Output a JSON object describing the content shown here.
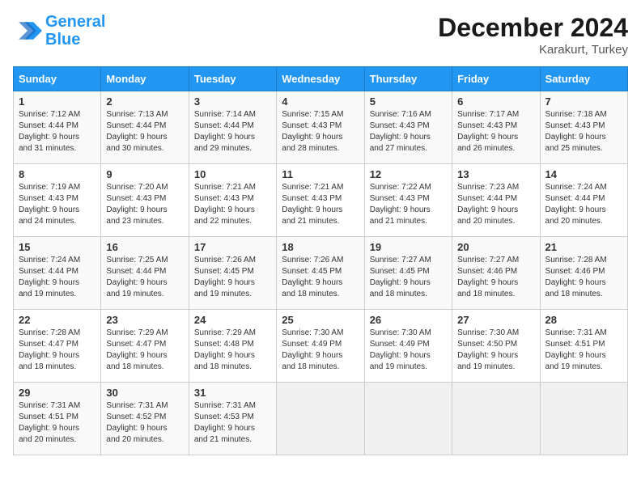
{
  "header": {
    "logo_line1": "General",
    "logo_line2": "Blue",
    "month": "December 2024",
    "location": "Karakurt, Turkey"
  },
  "days_of_week": [
    "Sunday",
    "Monday",
    "Tuesday",
    "Wednesday",
    "Thursday",
    "Friday",
    "Saturday"
  ],
  "weeks": [
    [
      {
        "day": "1",
        "info": "Sunrise: 7:12 AM\nSunset: 4:44 PM\nDaylight: 9 hours\nand 31 minutes."
      },
      {
        "day": "2",
        "info": "Sunrise: 7:13 AM\nSunset: 4:44 PM\nDaylight: 9 hours\nand 30 minutes."
      },
      {
        "day": "3",
        "info": "Sunrise: 7:14 AM\nSunset: 4:44 PM\nDaylight: 9 hours\nand 29 minutes."
      },
      {
        "day": "4",
        "info": "Sunrise: 7:15 AM\nSunset: 4:43 PM\nDaylight: 9 hours\nand 28 minutes."
      },
      {
        "day": "5",
        "info": "Sunrise: 7:16 AM\nSunset: 4:43 PM\nDaylight: 9 hours\nand 27 minutes."
      },
      {
        "day": "6",
        "info": "Sunrise: 7:17 AM\nSunset: 4:43 PM\nDaylight: 9 hours\nand 26 minutes."
      },
      {
        "day": "7",
        "info": "Sunrise: 7:18 AM\nSunset: 4:43 PM\nDaylight: 9 hours\nand 25 minutes."
      }
    ],
    [
      {
        "day": "8",
        "info": "Sunrise: 7:19 AM\nSunset: 4:43 PM\nDaylight: 9 hours\nand 24 minutes."
      },
      {
        "day": "9",
        "info": "Sunrise: 7:20 AM\nSunset: 4:43 PM\nDaylight: 9 hours\nand 23 minutes."
      },
      {
        "day": "10",
        "info": "Sunrise: 7:21 AM\nSunset: 4:43 PM\nDaylight: 9 hours\nand 22 minutes."
      },
      {
        "day": "11",
        "info": "Sunrise: 7:21 AM\nSunset: 4:43 PM\nDaylight: 9 hours\nand 21 minutes."
      },
      {
        "day": "12",
        "info": "Sunrise: 7:22 AM\nSunset: 4:43 PM\nDaylight: 9 hours\nand 21 minutes."
      },
      {
        "day": "13",
        "info": "Sunrise: 7:23 AM\nSunset: 4:44 PM\nDaylight: 9 hours\nand 20 minutes."
      },
      {
        "day": "14",
        "info": "Sunrise: 7:24 AM\nSunset: 4:44 PM\nDaylight: 9 hours\nand 20 minutes."
      }
    ],
    [
      {
        "day": "15",
        "info": "Sunrise: 7:24 AM\nSunset: 4:44 PM\nDaylight: 9 hours\nand 19 minutes."
      },
      {
        "day": "16",
        "info": "Sunrise: 7:25 AM\nSunset: 4:44 PM\nDaylight: 9 hours\nand 19 minutes."
      },
      {
        "day": "17",
        "info": "Sunrise: 7:26 AM\nSunset: 4:45 PM\nDaylight: 9 hours\nand 19 minutes."
      },
      {
        "day": "18",
        "info": "Sunrise: 7:26 AM\nSunset: 4:45 PM\nDaylight: 9 hours\nand 18 minutes."
      },
      {
        "day": "19",
        "info": "Sunrise: 7:27 AM\nSunset: 4:45 PM\nDaylight: 9 hours\nand 18 minutes."
      },
      {
        "day": "20",
        "info": "Sunrise: 7:27 AM\nSunset: 4:46 PM\nDaylight: 9 hours\nand 18 minutes."
      },
      {
        "day": "21",
        "info": "Sunrise: 7:28 AM\nSunset: 4:46 PM\nDaylight: 9 hours\nand 18 minutes."
      }
    ],
    [
      {
        "day": "22",
        "info": "Sunrise: 7:28 AM\nSunset: 4:47 PM\nDaylight: 9 hours\nand 18 minutes."
      },
      {
        "day": "23",
        "info": "Sunrise: 7:29 AM\nSunset: 4:47 PM\nDaylight: 9 hours\nand 18 minutes."
      },
      {
        "day": "24",
        "info": "Sunrise: 7:29 AM\nSunset: 4:48 PM\nDaylight: 9 hours\nand 18 minutes."
      },
      {
        "day": "25",
        "info": "Sunrise: 7:30 AM\nSunset: 4:49 PM\nDaylight: 9 hours\nand 18 minutes."
      },
      {
        "day": "26",
        "info": "Sunrise: 7:30 AM\nSunset: 4:49 PM\nDaylight: 9 hours\nand 19 minutes."
      },
      {
        "day": "27",
        "info": "Sunrise: 7:30 AM\nSunset: 4:50 PM\nDaylight: 9 hours\nand 19 minutes."
      },
      {
        "day": "28",
        "info": "Sunrise: 7:31 AM\nSunset: 4:51 PM\nDaylight: 9 hours\nand 19 minutes."
      }
    ],
    [
      {
        "day": "29",
        "info": "Sunrise: 7:31 AM\nSunset: 4:51 PM\nDaylight: 9 hours\nand 20 minutes."
      },
      {
        "day": "30",
        "info": "Sunrise: 7:31 AM\nSunset: 4:52 PM\nDaylight: 9 hours\nand 20 minutes."
      },
      {
        "day": "31",
        "info": "Sunrise: 7:31 AM\nSunset: 4:53 PM\nDaylight: 9 hours\nand 21 minutes."
      },
      {
        "day": "",
        "info": ""
      },
      {
        "day": "",
        "info": ""
      },
      {
        "day": "",
        "info": ""
      },
      {
        "day": "",
        "info": ""
      }
    ]
  ]
}
